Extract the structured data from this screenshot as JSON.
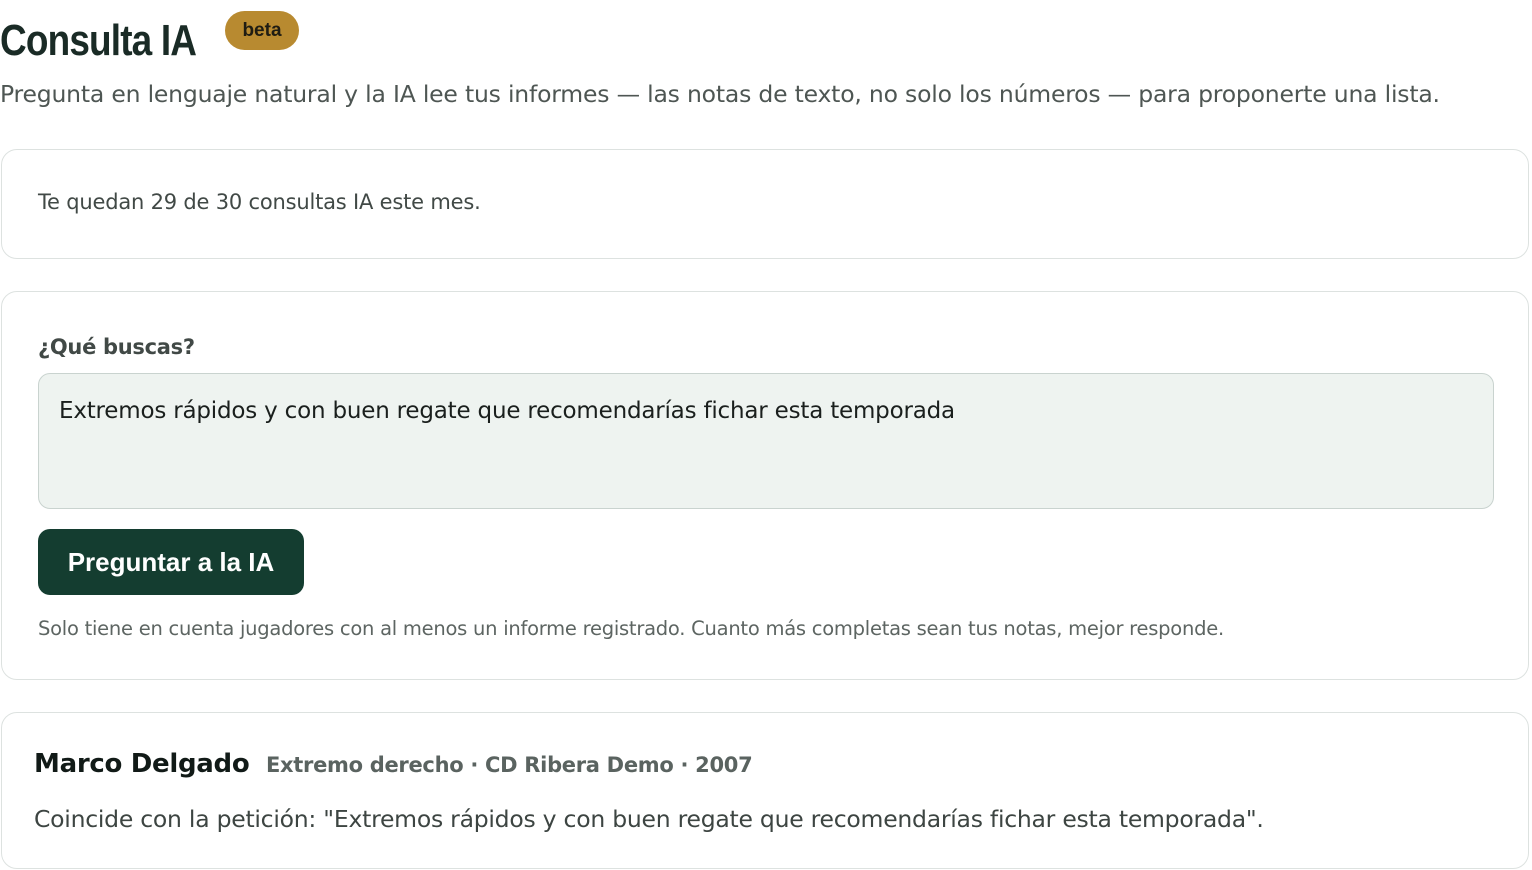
{
  "header": {
    "title": "Consulta IA",
    "badge": "beta",
    "subtitle": "Pregunta en lenguaje natural y la IA lee tus informes — las notas de texto, no solo los números — para proponerte una lista."
  },
  "quota": {
    "text": "Te quedan 29 de 30 consultas IA este mes."
  },
  "query": {
    "label": "¿Qué buscas?",
    "value": "Extremos rápidos y con buen regate que recomendarías fichar esta temporada",
    "button_label": "Preguntar a la IA",
    "hint": "Solo tiene en cuenta jugadores con al menos un informe registrado. Cuanto más completas sean tus notas, mejor responde."
  },
  "results": [
    {
      "name": "Marco Delgado",
      "meta": "Extremo derecho · CD Ribera Demo · 2007",
      "reason": "Coincide con la petición: \"Extremos rápidos y con buen regate que recomendarías fichar esta temporada\"."
    }
  ]
}
